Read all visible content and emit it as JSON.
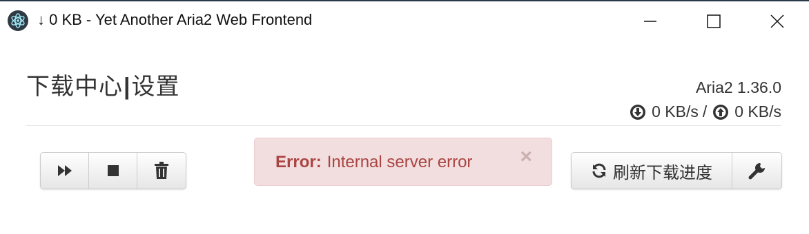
{
  "window": {
    "title": "↓ 0 KB - Yet Another Aria2 Web Frontend",
    "minimize_icon": "minimize-icon",
    "maximize_icon": "maximize-icon",
    "close_icon": "close-icon"
  },
  "header": {
    "nav_primary": "下载中心",
    "nav_separator": "|",
    "nav_secondary": "设置",
    "version": "Aria2 1.36.0",
    "download_speed": "0 KB/s",
    "speed_separator": "/",
    "upload_speed": "0 KB/s"
  },
  "toolbar": {
    "left_buttons": [
      "start-all-icon",
      "stop-icon",
      "trash-icon"
    ],
    "refresh_label": "刷新下载进度",
    "refresh_icon": "refresh-icon",
    "settings_icon": "wrench-icon"
  },
  "alert": {
    "label": "Error:",
    "message": "Internal server error",
    "close": "×",
    "color": "#a94442",
    "background": "#f2dede"
  },
  "colors": {
    "titlebar_accent": "#2b3a48",
    "text": "#333333"
  }
}
